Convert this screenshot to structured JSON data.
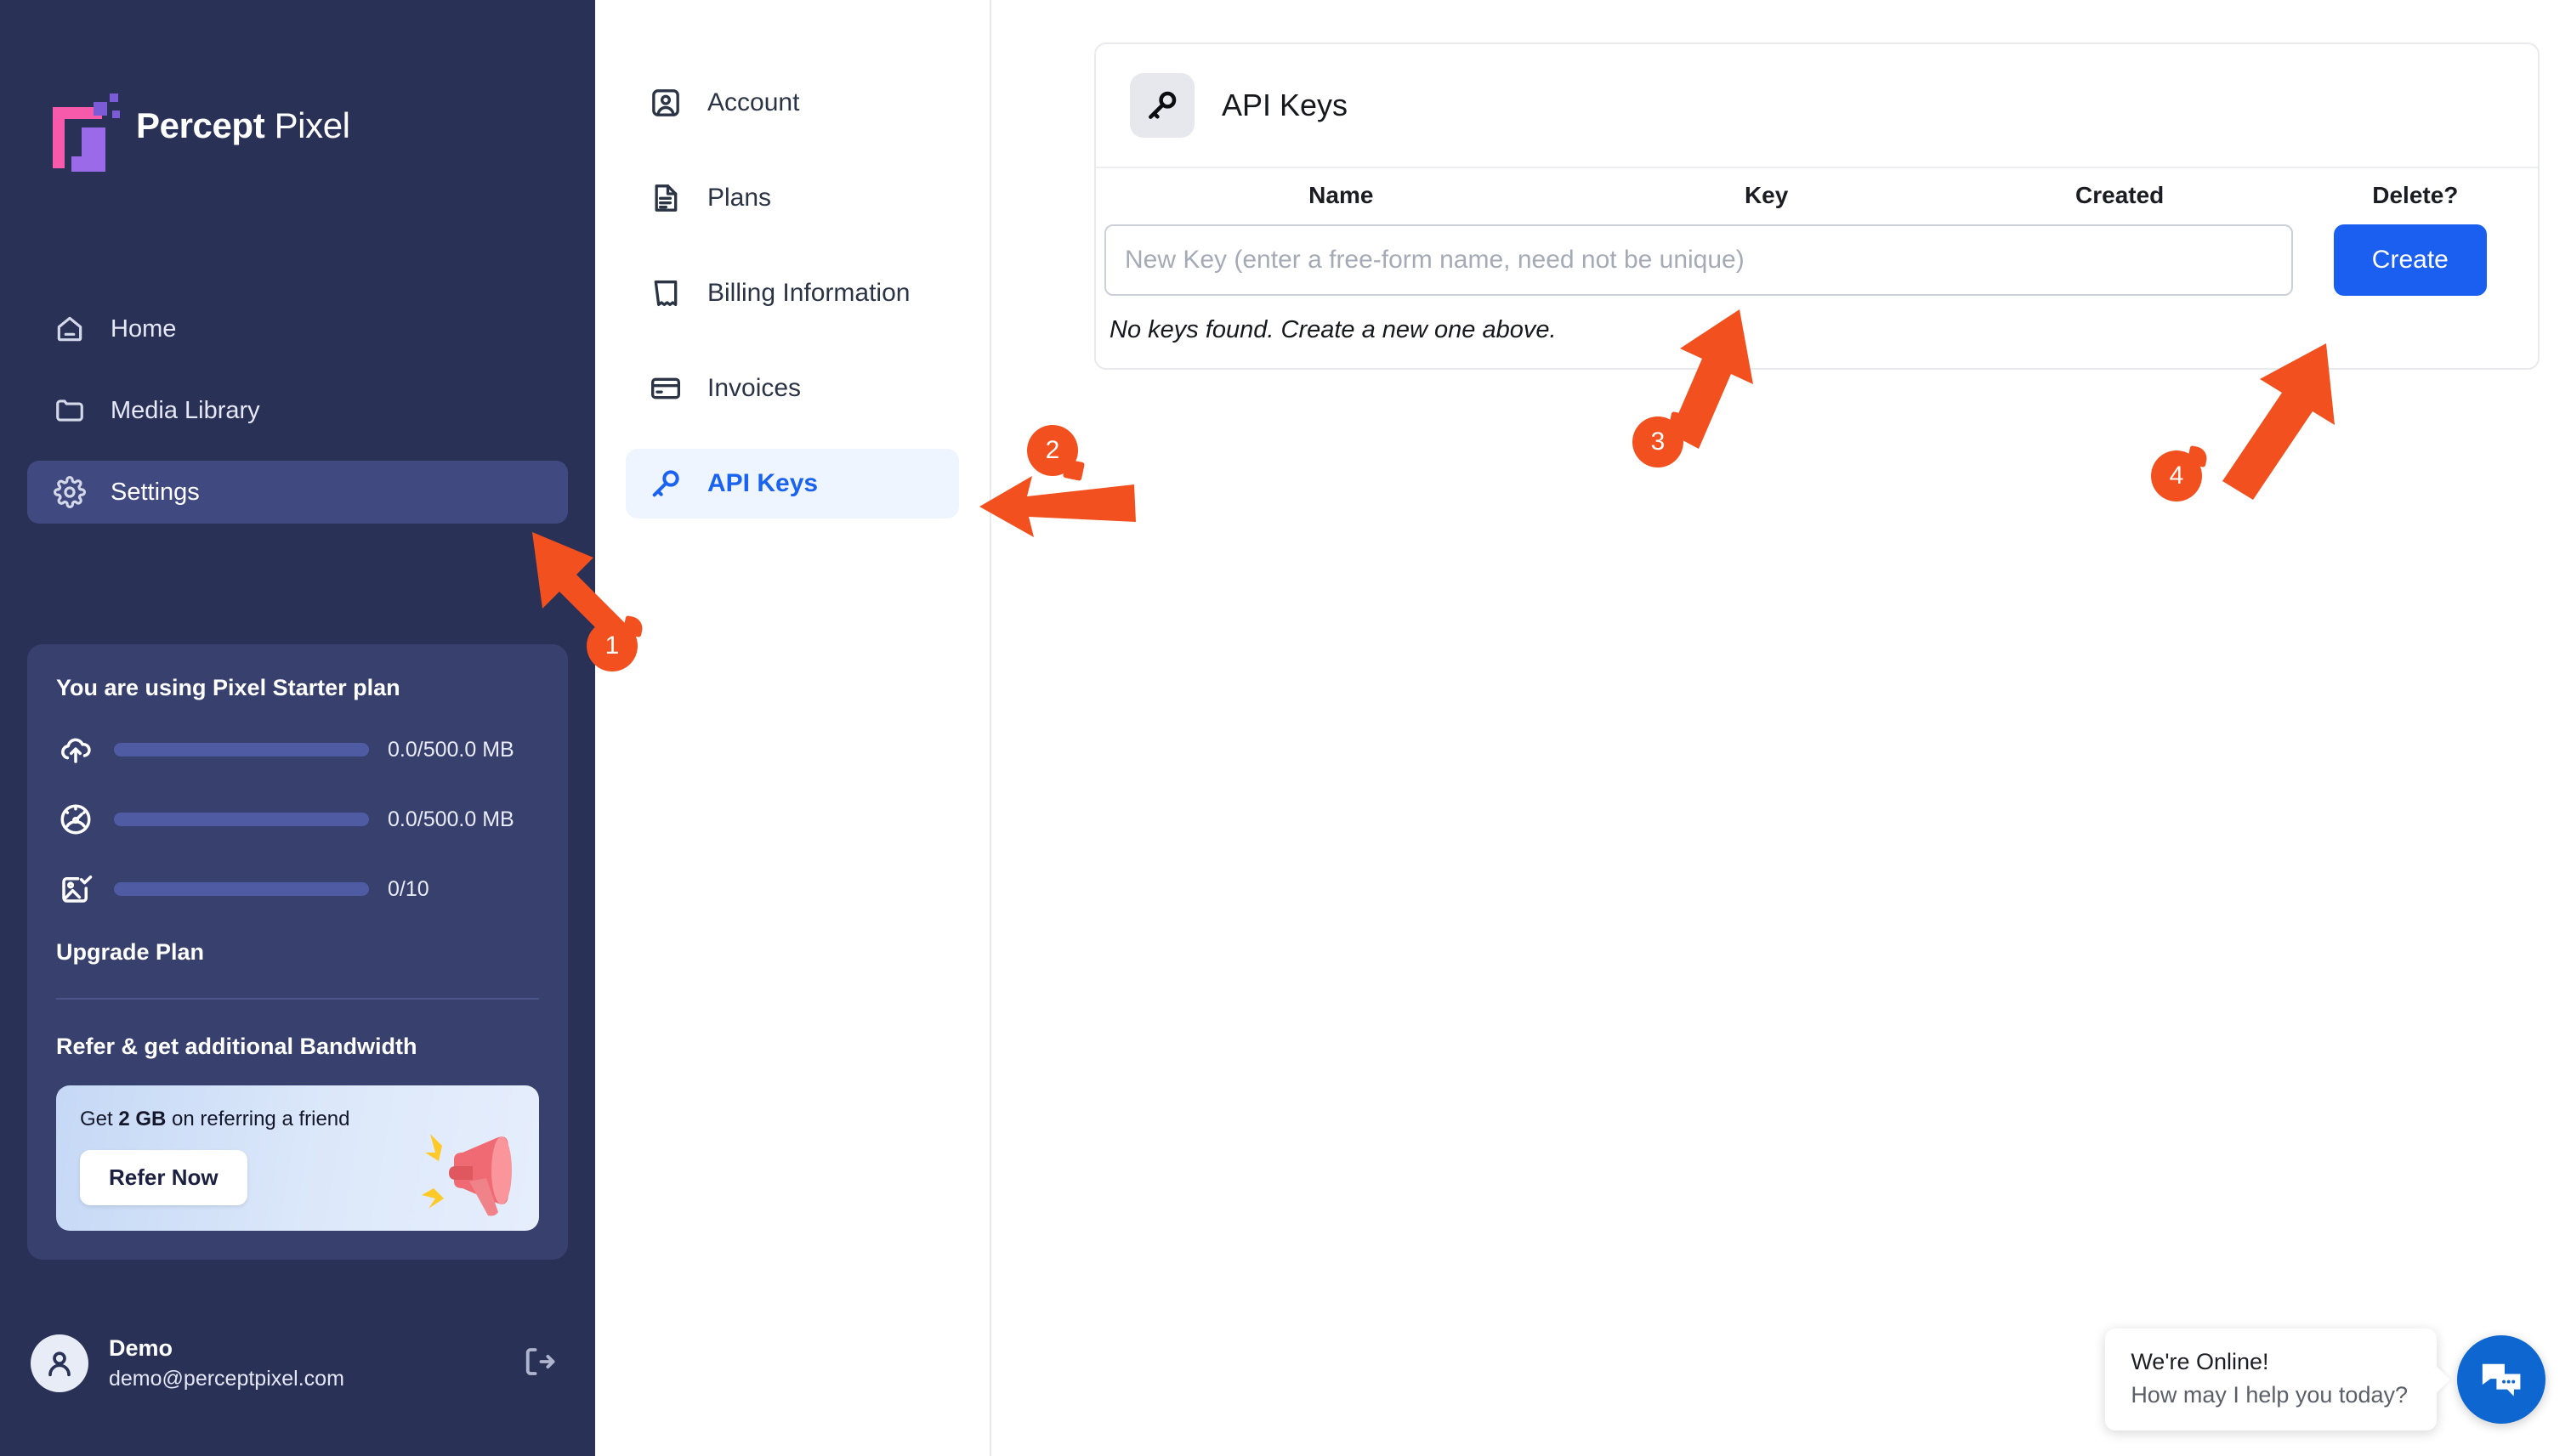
{
  "brand": {
    "name_bold": "Percept",
    "name_light": "Pixel",
    "logo_icon": "percept-pixel-logo"
  },
  "sidebar": {
    "items": [
      {
        "label": "Home",
        "icon": "home-icon",
        "active": false
      },
      {
        "label": "Media Library",
        "icon": "folder-icon",
        "active": false
      },
      {
        "label": "Settings",
        "icon": "gear-icon",
        "active": true
      }
    ],
    "plan_card": {
      "title": "You are using Pixel Starter plan",
      "usage": [
        {
          "icon": "cloud-upload-icon",
          "label": "0.0/500.0 MB",
          "percent": 0
        },
        {
          "icon": "speedometer-icon",
          "label": "0.0/500.0 MB",
          "percent": 0
        },
        {
          "icon": "image-check-icon",
          "label": "0/10",
          "percent": 0
        }
      ],
      "upgrade_label": "Upgrade Plan",
      "refer_title": "Refer & get additional Bandwidth",
      "refer_text_pre": "Get ",
      "refer_text_bold": "2 GB",
      "refer_text_post": " on referring a friend",
      "refer_button": "Refer Now",
      "refer_icon": "megaphone-icon"
    },
    "user": {
      "name": "Demo",
      "email": "demo@perceptpixel.com",
      "avatar_icon": "user-avatar-icon",
      "logout_icon": "logout-icon"
    }
  },
  "subnav": {
    "items": [
      {
        "label": "Account",
        "icon": "user-card-icon",
        "active": false
      },
      {
        "label": "Plans",
        "icon": "document-icon",
        "active": false
      },
      {
        "label": "Billing Information",
        "icon": "receipt-icon",
        "active": false
      },
      {
        "label": "Invoices",
        "icon": "credit-card-icon",
        "active": false
      },
      {
        "label": "API Keys",
        "icon": "key-icon",
        "active": true
      }
    ]
  },
  "main": {
    "panel_title": "API Keys",
    "panel_icon": "key-icon",
    "table": {
      "headers": [
        "Name",
        "Key",
        "Created",
        "Delete?"
      ],
      "rows": [],
      "new_key_placeholder": "New Key (enter a free-form name, need not be unique)",
      "new_key_value": "",
      "create_button": "Create",
      "empty_message": "No keys found. Create a new one above."
    }
  },
  "chat": {
    "line1": "We're Online!",
    "line2": "How may I help you today?",
    "fab_icon": "chat-bubbles-icon"
  },
  "annotations": {
    "markers": [
      {
        "number": "1",
        "target": "sidebar-item-settings"
      },
      {
        "number": "2",
        "target": "subnav-item-api-keys"
      },
      {
        "number": "3",
        "target": "new-key-input"
      },
      {
        "number": "4",
        "target": "create-key-button"
      }
    ]
  },
  "colors": {
    "sidebar_bg": "#2a3157",
    "sidebar_active": "#414a80",
    "accent_blue": "#1a62f0",
    "annotation_orange": "#f2501e",
    "logo_pink": "#f759ab",
    "logo_purple": "#9a6ae8",
    "chat_blue": "#0e66d0"
  }
}
